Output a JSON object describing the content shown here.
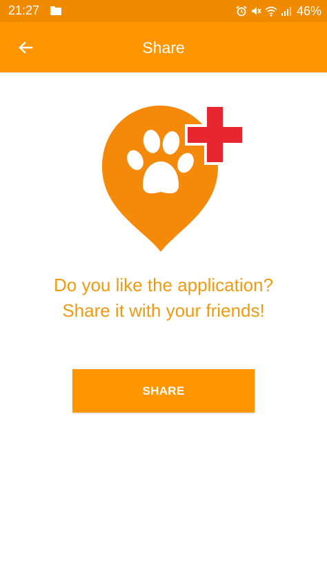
{
  "status_bar": {
    "time": "21:27",
    "battery": "46%",
    "icons": [
      "folder-icon",
      "alarm-icon",
      "mute-icon",
      "wifi-icon",
      "signal-icon"
    ]
  },
  "app_bar": {
    "title": "Share",
    "back_icon": "arrow-back-icon"
  },
  "logo": {
    "icons": [
      "map-pin-icon",
      "paw-icon",
      "red-cross-icon"
    ]
  },
  "prompt": {
    "line1": "Do you like the application?",
    "line2": "Share it with your friends!"
  },
  "share_button": {
    "label": "SHARE"
  },
  "colors": {
    "status_bar": "#f08a00",
    "app_bar": "#ff9500",
    "accent_text": "#f09a12",
    "logo_orange": "#f5890a",
    "cross_red": "#e8262f",
    "background": "#ffffff"
  }
}
